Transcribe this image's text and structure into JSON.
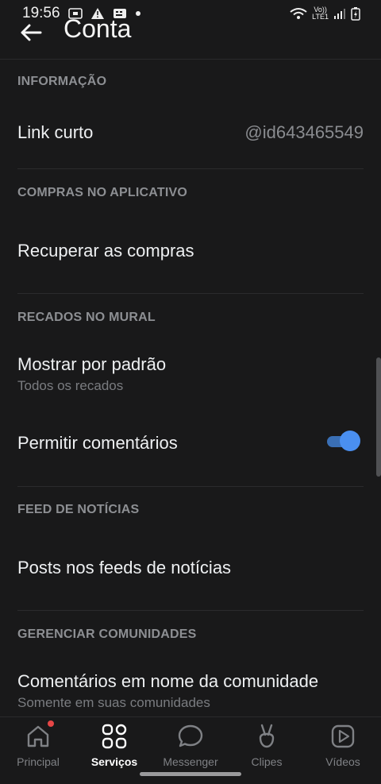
{
  "status_bar": {
    "time": "19:56",
    "lte": "LTE1",
    "volte": "Vo))"
  },
  "header": {
    "title": "Conta"
  },
  "sections": {
    "info": {
      "title": "INFORMAÇÃO",
      "link_label": "Link curto",
      "link_value": "@id643465549"
    },
    "purchases": {
      "title": "COMPRAS NO APLICATIVO",
      "restore_label": "Recuperar as compras"
    },
    "wall": {
      "title": "RECADOS NO MURAL",
      "show_default_label": "Mostrar por padrão",
      "show_default_value": "Todos os recados",
      "allow_comments_label": "Permitir comentários",
      "allow_comments_on": true
    },
    "feed": {
      "title": "FEED DE NOTÍCIAS",
      "posts_label": "Posts nos feeds de notícias"
    },
    "communities": {
      "title": "GERENCIAR COMUNIDADES",
      "comments_label": "Comentários em nome da comunidade",
      "comments_value": "Somente em suas comunidades"
    }
  },
  "tabbar": {
    "tabs": [
      {
        "label": "Principal",
        "icon": "home-icon",
        "badge": true
      },
      {
        "label": "Serviços",
        "icon": "services-icon",
        "active": true
      },
      {
        "label": "Messenger",
        "icon": "messenger-icon"
      },
      {
        "label": "Clipes",
        "icon": "clips-icon"
      },
      {
        "label": "Vídeos",
        "icon": "videos-icon"
      }
    ]
  },
  "colors": {
    "accent": "#4a8ff0",
    "background": "#19191a",
    "badge": "#e64646"
  }
}
